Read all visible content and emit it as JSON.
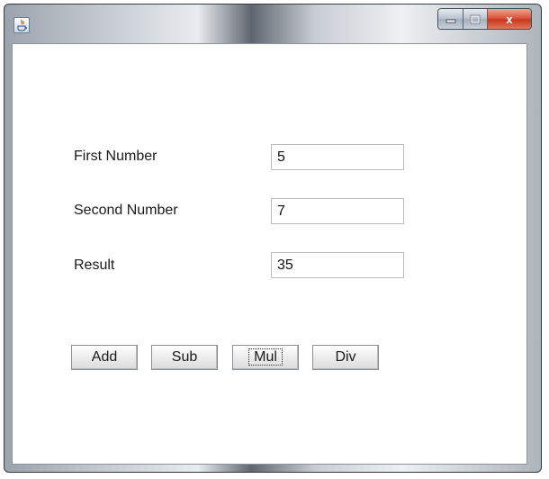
{
  "window": {
    "title": "",
    "caption_buttons": {
      "minimize_icon": "minimize-icon",
      "maximize_icon": "maximize-icon",
      "close_icon": "close-icon",
      "close_glyph": "x"
    },
    "app_icon": "java-icon"
  },
  "form": {
    "first_label": "First Number",
    "first_value": "5",
    "second_label": "Second Number",
    "second_value": "7",
    "result_label": "Result",
    "result_value": "35"
  },
  "buttons": {
    "add": "Add",
    "sub": "Sub",
    "mul": "Mul",
    "div": "Div",
    "focused": "mul"
  },
  "colors": {
    "close_button": "#c8381d",
    "client_background": "#ffffff"
  }
}
